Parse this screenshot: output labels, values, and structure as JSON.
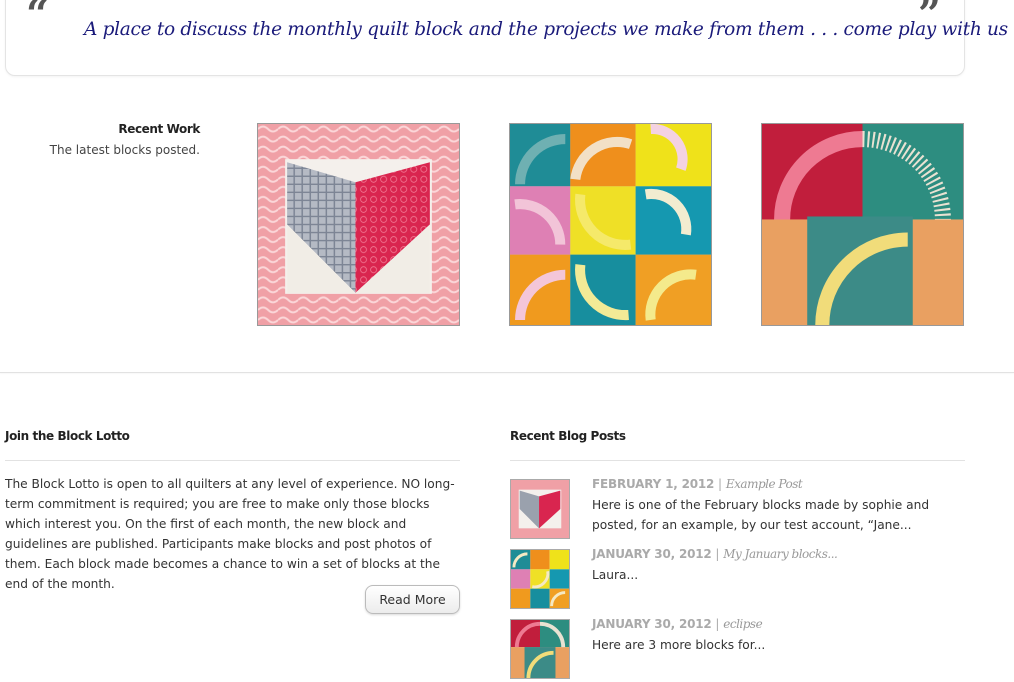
{
  "tagline": {
    "open_quote": "“",
    "text": "A place to discuss the monthly quilt block and the projects we make from them . . . come play with us",
    "close_quote": "”"
  },
  "recent_work": {
    "heading": "Recent Work",
    "subtitle": "The latest blocks posted.",
    "items": [
      {
        "image": "heart-quilt-block"
      },
      {
        "image": "arc-nine-patch-quilt-block"
      },
      {
        "image": "arc-four-patch-quilt-block"
      }
    ]
  },
  "join": {
    "heading": "Join the Block Lotto",
    "body": "The Block Lotto is open to all quilters at any level of experience.  NO long-term commitment is required; you are free to make only those blocks which interest you.  On the first of each month, the new block and guidelines are published.  Participants make blocks and post photos of them.  Each block made becomes a chance to win a set of blocks at the end of the month.",
    "read_more": "Read More"
  },
  "blog": {
    "heading": "Recent Blog Posts",
    "separator": "|",
    "posts": [
      {
        "date": "FEBRUARY 1, 2012",
        "title": "Example Post",
        "excerpt": "Here is one of the February blocks made by sophie and posted, for an example, by our test account, “Jane..."
      },
      {
        "date": "JANUARY 30, 2012",
        "title": "My January blocks...",
        "excerpt": "Laura..."
      },
      {
        "date": "JANUARY 30, 2012",
        "title": "eclipse",
        "excerpt": "Here are 3 more blocks for..."
      }
    ]
  },
  "colors": {
    "tagline": "#1a1a7a",
    "heart_red": "#d9254f",
    "border_pink": "#e8868f",
    "teal": "#1e8fa0",
    "orange": "#ef9a1e",
    "yellow": "#efe21a"
  }
}
